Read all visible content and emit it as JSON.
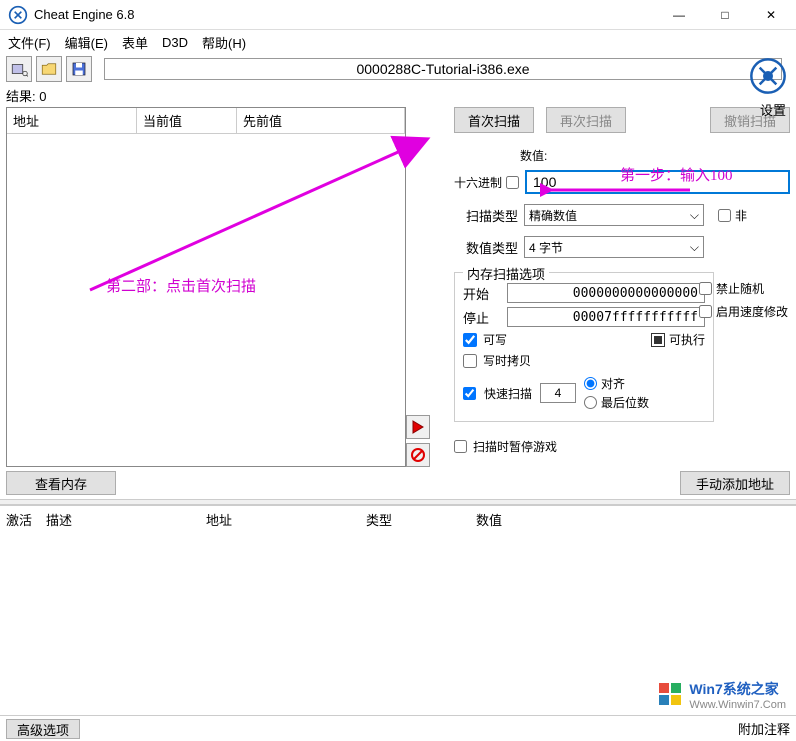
{
  "window": {
    "title": "Cheat Engine 6.8",
    "minimize": "—",
    "maximize": "□",
    "close": "✕"
  },
  "menu": {
    "file": "文件(F)",
    "edit": "编辑(E)",
    "table": "表单",
    "d3d": "D3D",
    "help": "帮助(H)"
  },
  "process_name": "0000288C-Tutorial-i386.exe",
  "settings_label": "设置",
  "results_label": "结果: 0",
  "results_headers": {
    "addr": "地址",
    "current": "当前值",
    "prev": "先前值"
  },
  "scan": {
    "first": "首次扫描",
    "next": "再次扫描",
    "undo": "撤销扫描",
    "value_label": "数值:",
    "hex_label": "十六进制",
    "value_input": "100",
    "scan_type_label": "扫描类型",
    "scan_type_value": "精确数值",
    "not_label": "非",
    "value_type_label": "数值类型",
    "value_type_value": "4 字节"
  },
  "mem": {
    "legend": "内存扫描选项",
    "start_label": "开始",
    "start_value": "0000000000000000",
    "stop_label": "停止",
    "stop_value": "00007fffffffffff",
    "writable": "可写",
    "executable": "可执行",
    "cow": "写时拷贝",
    "fast_scan": "快速扫描",
    "fast_value": "4",
    "align": "对齐",
    "last_digits": "最后位数",
    "pause": "扫描时暂停游戏"
  },
  "side": {
    "no_random": "禁止随机",
    "speed_mod": "启用速度修改"
  },
  "bottom": {
    "view_mem": "查看内存",
    "add_manual": "手动添加地址"
  },
  "addr_list": {
    "active": "激活",
    "desc": "描述",
    "addr": "地址",
    "type": "类型",
    "value": "数值"
  },
  "footer": {
    "advanced": "高级选项",
    "attach": "附加注释"
  },
  "annotations": {
    "step1": "第一步：输入100",
    "step2": "第二部：点击首次扫描"
  },
  "watermark": {
    "line1": "Win7系统之家",
    "line2": "Www.Winwin7.Com"
  }
}
